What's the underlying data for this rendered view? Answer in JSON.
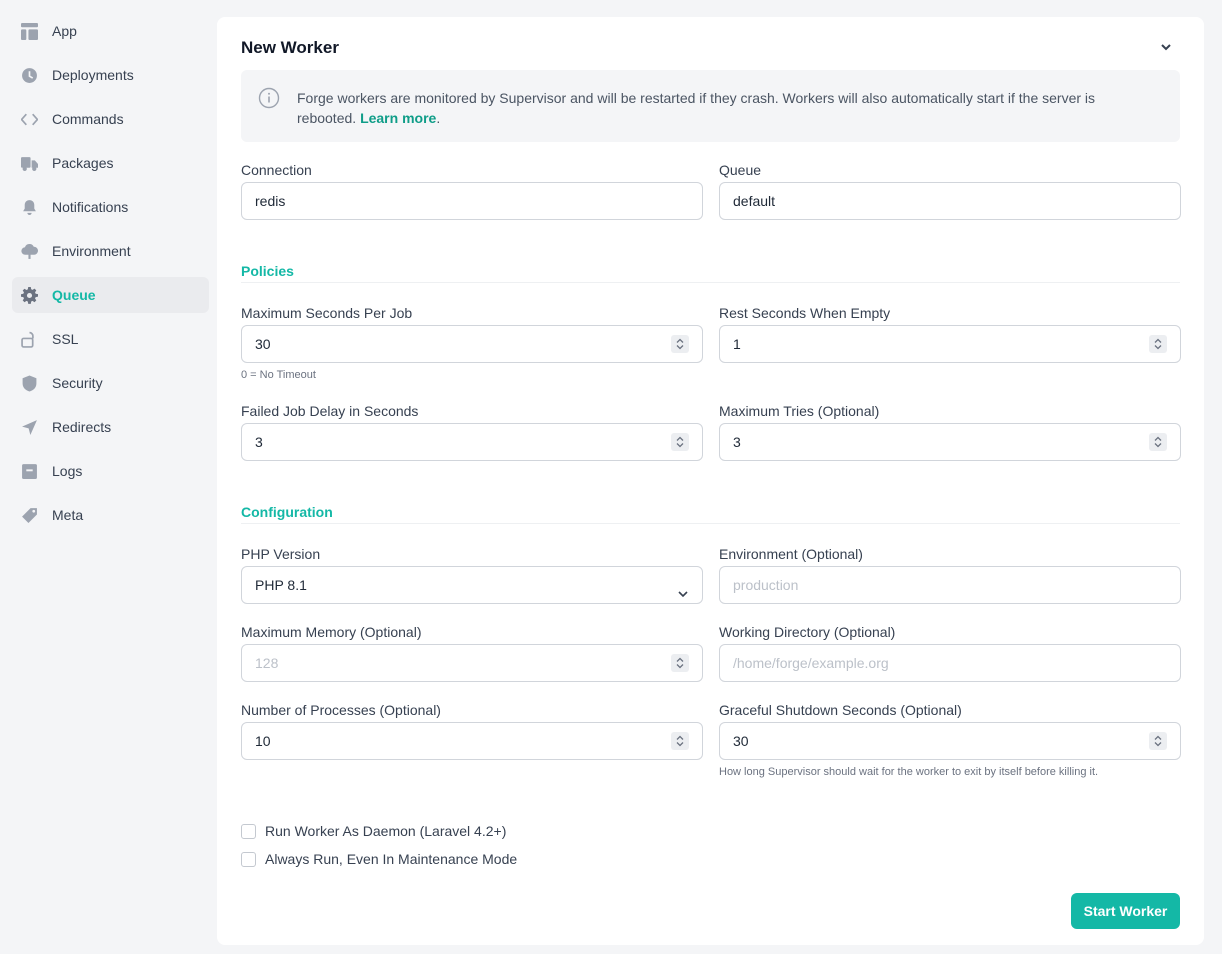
{
  "sidebar": {
    "items": [
      {
        "label": "App",
        "icon": "app-layout-icon",
        "active": false
      },
      {
        "label": "Deployments",
        "icon": "clock-icon",
        "active": false
      },
      {
        "label": "Commands",
        "icon": "code-icon",
        "active": false
      },
      {
        "label": "Packages",
        "icon": "truck-icon",
        "active": false
      },
      {
        "label": "Notifications",
        "icon": "bell-icon",
        "active": false
      },
      {
        "label": "Environment",
        "icon": "cloud-tree-icon",
        "active": false
      },
      {
        "label": "Queue",
        "icon": "gear-icon",
        "active": true
      },
      {
        "label": "SSL",
        "icon": "lock-open-icon",
        "active": false
      },
      {
        "label": "Security",
        "icon": "shield-icon",
        "active": false
      },
      {
        "label": "Redirects",
        "icon": "location-arrow-icon",
        "active": false
      },
      {
        "label": "Logs",
        "icon": "archive-icon",
        "active": false
      },
      {
        "label": "Meta",
        "icon": "tag-icon",
        "active": false
      }
    ]
  },
  "panel": {
    "title": "New Worker",
    "info_text": "Forge workers are monitored by Supervisor and will be restarted if they crash. Workers will also automatically start if the server is rebooted.",
    "info_link": "Learn more",
    "info_suffix": "."
  },
  "fields": {
    "connection": {
      "label": "Connection",
      "value": "redis"
    },
    "queue": {
      "label": "Queue",
      "value": "default"
    },
    "max_seconds": {
      "label": "Maximum Seconds Per Job",
      "value": "30",
      "hint": "0 = No Timeout"
    },
    "rest_seconds": {
      "label": "Rest Seconds When Empty",
      "value": "1"
    },
    "failed_delay": {
      "label": "Failed Job Delay in Seconds",
      "value": "3"
    },
    "max_tries": {
      "label": "Maximum Tries (Optional)",
      "value": "3"
    },
    "php_version": {
      "label": "PHP Version",
      "value": "PHP 8.1"
    },
    "environment": {
      "label": "Environment (Optional)",
      "placeholder": "production"
    },
    "max_memory": {
      "label": "Maximum Memory (Optional)",
      "placeholder": "128"
    },
    "working_dir": {
      "label": "Working Directory (Optional)",
      "placeholder": "/home/forge/example.org"
    },
    "num_processes": {
      "label": "Number of Processes (Optional)",
      "value": "10"
    },
    "graceful_shutdown": {
      "label": "Graceful Shutdown Seconds (Optional)",
      "value": "30",
      "hint": "How long Supervisor should wait for the worker to exit by itself before killing it."
    }
  },
  "sections": {
    "policies": "Policies",
    "configuration": "Configuration"
  },
  "checkboxes": {
    "daemon": {
      "label": "Run Worker As Daemon (Laravel 4.2+)",
      "checked": false
    },
    "maintenance": {
      "label": "Always Run, Even In Maintenance Mode",
      "checked": false
    }
  },
  "actions": {
    "start_worker": "Start Worker"
  },
  "colors": {
    "accent": "#14b8a6",
    "background": "#f4f5f7"
  }
}
